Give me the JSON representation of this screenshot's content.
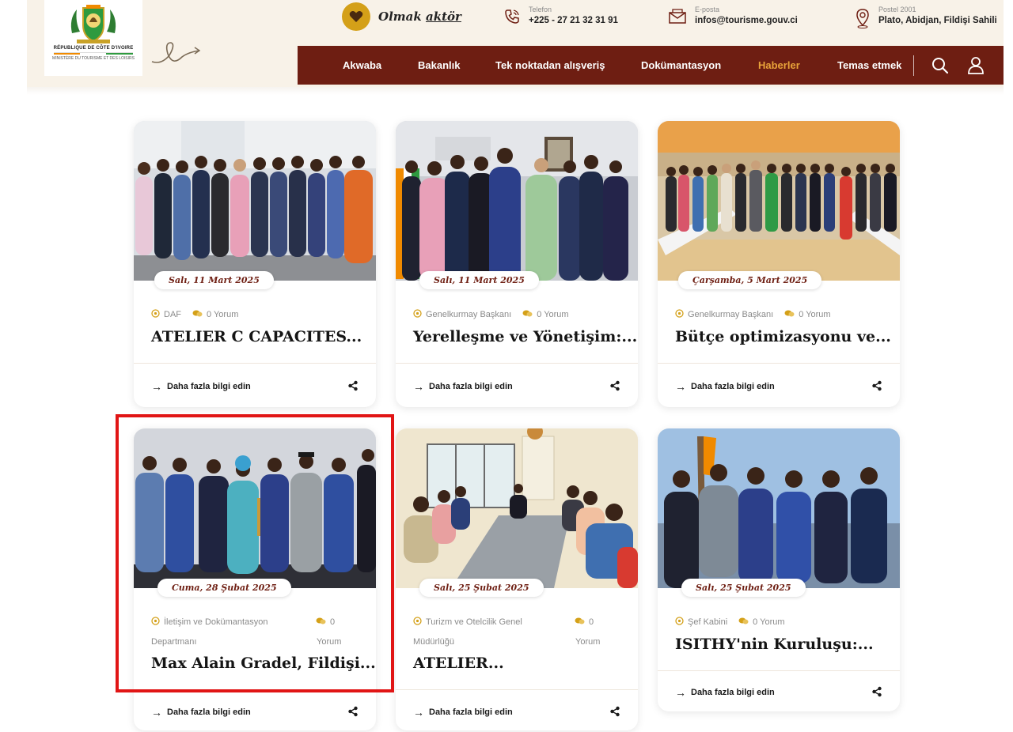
{
  "header": {
    "logo": {
      "line1": "RÉPUBLIQUE DE CÔTE D'IVOIRE",
      "line2": "MINISTÈRE DU TOURISME ET DES LOISIRS"
    },
    "tagline_part1": "Olmak",
    "tagline_part2": "aktör",
    "contacts": [
      {
        "icon": "phone-icon",
        "label": "Telefon",
        "value": "+225 - 27 21 32 31 91"
      },
      {
        "icon": "mail-icon",
        "label": "E-posta",
        "value": "infos@tourisme.gouv.ci"
      },
      {
        "icon": "location-pin-icon",
        "label": "Postel 2001",
        "value": "Plato, Abidjan, Fildişi Sahili"
      }
    ]
  },
  "nav": {
    "items": [
      "Akwaba",
      "Bakanlık",
      "Tek noktadan alışveriş",
      "Dokümantasyon",
      "Haberler",
      "Temas etmek"
    ],
    "active": "Haberler",
    "active_color": "#e8a33a",
    "bar_color": "#6e1e12"
  },
  "cards": [
    {
      "date": "Salı, 11 Mart 2025",
      "category": "DAF",
      "comments": "0 Yorum",
      "title": "ATELIER C CAPACITES...",
      "more": "Daha fazla bilgi edin"
    },
    {
      "date": "Salı, 11 Mart 2025",
      "category": "Genelkurmay Başkanı",
      "comments": "0 Yorum",
      "title": "Yerelleşme ve Yönetişim:...",
      "more": "Daha fazla bilgi edin"
    },
    {
      "date": "Çarşamba, 5 Mart 2025",
      "category": "Genelkurmay Başkanı",
      "comments": "0 Yorum",
      "title": "Bütçe optimizasyonu ve...",
      "more": "Daha fazla bilgi edin"
    },
    {
      "date": "Cuma, 28 Şubat 2025",
      "category_line1": "İletişim ve Dokümantasyon",
      "category_line2": "Departmanı",
      "comments_line1": "0",
      "comments_line2": "Yorum",
      "title": "Max Alain Gradel, Fildişi...",
      "more": "Daha fazla bilgi edin",
      "highlighted": true
    },
    {
      "date": "Salı, 25 Şubat 2025",
      "category_line1": "Turizm ve Otelcilik Genel",
      "category_line2": "Müdürlüğü",
      "comments_line1": "0",
      "comments_line2": "Yorum",
      "title": "ATELIER...",
      "more": "Daha fazla bilgi edin"
    },
    {
      "date": "Salı, 25 Şubat 2025",
      "category": "Şef Kabini",
      "comments": "0 Yorum",
      "title": "ISITHY'nin Kuruluşu:...",
      "more": "Daha fazla bilgi edin"
    }
  ],
  "colors": {
    "highlight": "#e11515",
    "date_text": "#6e1e12",
    "accent_gold": "#d4a018"
  }
}
